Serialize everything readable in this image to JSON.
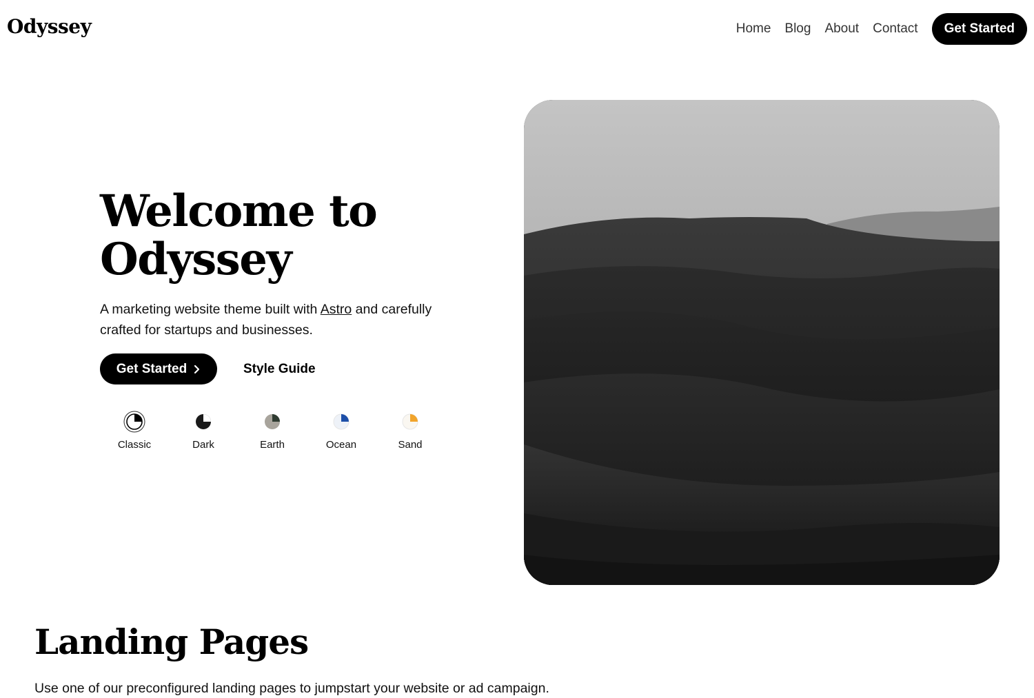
{
  "header": {
    "logo": "Odyssey",
    "nav": [
      "Home",
      "Blog",
      "About",
      "Contact"
    ],
    "cta_label": "Get Started"
  },
  "hero": {
    "title_line1": "Welcome to",
    "title_line2": "Odyssey",
    "subtitle_before": "A marketing website theme built with ",
    "subtitle_link": "Astro",
    "subtitle_after": " and carefully crafted for startups and businesses.",
    "primary_button": "Get Started",
    "primary_button_icon": "chevron-right-icon",
    "secondary_button": "Style Guide",
    "themes": [
      {
        "label": "Classic",
        "selected": true,
        "ring": "#ffffff",
        "accent": "#000000"
      },
      {
        "label": "Dark",
        "selected": false,
        "ring": "#1a1a1a",
        "accent": "#ffffff"
      },
      {
        "label": "Earth",
        "selected": false,
        "ring": "#a8a49c",
        "accent": "#2f3b31"
      },
      {
        "label": "Ocean",
        "selected": false,
        "ring": "#eef2f8",
        "accent": "#1d4fa8"
      },
      {
        "label": "Sand",
        "selected": false,
        "ring": "#faf7f1",
        "accent": "#f1a42c"
      }
    ],
    "image_alt": "desert-dunes-image"
  },
  "section": {
    "title": "Landing Pages",
    "subtitle": "Use one of our preconfigured landing pages to jumpstart your website or ad campaign."
  }
}
